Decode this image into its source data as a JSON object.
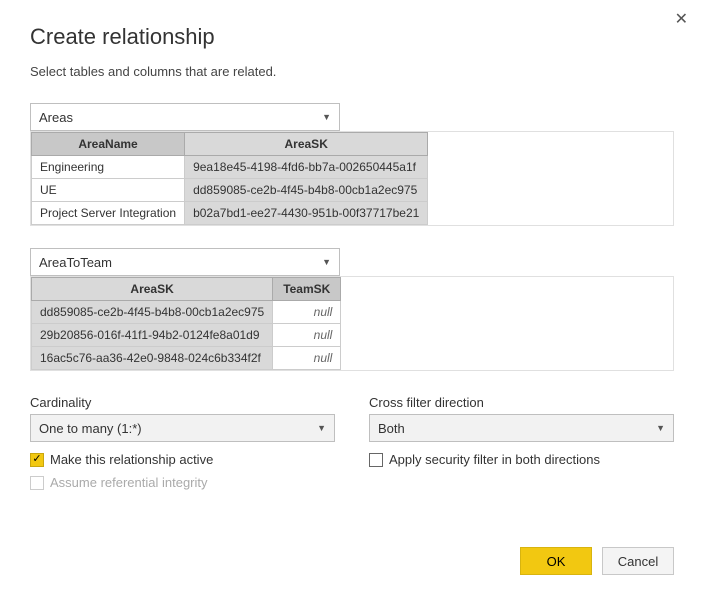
{
  "dialog": {
    "title": "Create relationship",
    "subtitle": "Select tables and columns that are related."
  },
  "table1": {
    "selected": "Areas",
    "columns": [
      "AreaName",
      "AreaSK"
    ],
    "selectedColIndex": 1,
    "rows": [
      [
        "Engineering",
        "9ea18e45-4198-4fd6-bb7a-002650445a1f"
      ],
      [
        "UE",
        "dd859085-ce2b-4f45-b4b8-00cb1a2ec975"
      ],
      [
        "Project Server Integration",
        "b02a7bd1-ee27-4430-951b-00f37717be21"
      ]
    ]
  },
  "table2": {
    "selected": "AreaToTeam",
    "columns": [
      "AreaSK",
      "TeamSK"
    ],
    "selectedColIndex": 0,
    "rows": [
      [
        "dd859085-ce2b-4f45-b4b8-00cb1a2ec975",
        "null"
      ],
      [
        "29b20856-016f-41f1-94b2-0124fe8a01d9",
        "null"
      ],
      [
        "16ac5c76-aa36-42e0-9848-024c6b334f2f",
        "null"
      ]
    ]
  },
  "cardinality": {
    "label": "Cardinality",
    "value": "One to many (1:*)"
  },
  "crossfilter": {
    "label": "Cross filter direction",
    "value": "Both"
  },
  "checks": {
    "active": "Make this relationship active",
    "security": "Apply security filter in both directions",
    "referential": "Assume referential integrity"
  },
  "buttons": {
    "ok": "OK",
    "cancel": "Cancel"
  }
}
